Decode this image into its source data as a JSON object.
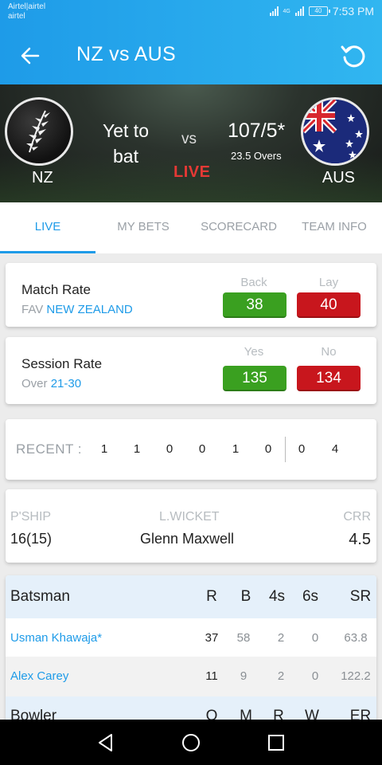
{
  "statusbar": {
    "carrier1": "Airtel|airtel",
    "carrier2": "airtel",
    "network": "4G",
    "battery": "40",
    "time": "7:53 PM"
  },
  "appbar": {
    "title": "NZ vs AUS"
  },
  "match": {
    "home_code": "NZ",
    "away_code": "AUS",
    "home_status": "Yet to bat",
    "vs": "vs",
    "live": "LIVE",
    "away_score": "107/5*",
    "away_overs": "23.5 Overs"
  },
  "tabs": [
    "LIVE",
    "MY BETS",
    "SCORECARD",
    "TEAM INFO"
  ],
  "match_rate": {
    "title": "Match Rate",
    "sub_prefix": "FAV",
    "sub_value": "NEW ZEALAND",
    "back_label": "Back",
    "lay_label": "Lay",
    "back": "38",
    "lay": "40"
  },
  "session_rate": {
    "title": "Session Rate",
    "sub_prefix": "Over",
    "sub_value": "21-30",
    "yes_label": "Yes",
    "no_label": "No",
    "yes": "135",
    "no": "134"
  },
  "recent": {
    "label": "RECENT :",
    "balls": [
      "1",
      "1",
      "0",
      "0",
      "1",
      "0",
      "0",
      "4"
    ]
  },
  "partnership": {
    "pship_label": "P'SHIP",
    "pship_value": "16(15)",
    "wicket_label": "L.WICKET",
    "wicket_value": "Glenn Maxwell",
    "crr_label": "CRR",
    "crr_value": "4.5"
  },
  "batting": {
    "headers": [
      "Batsman",
      "R",
      "B",
      "4s",
      "6s",
      "SR"
    ],
    "rows": [
      [
        "Usman Khawaja*",
        "37",
        "58",
        "2",
        "0",
        "63.8"
      ],
      [
        "Alex Carey",
        "11",
        "9",
        "2",
        "0",
        "122.2"
      ]
    ],
    "bowler_headers": [
      "Bowler",
      "O",
      "M",
      "R",
      "W",
      "ER"
    ]
  },
  "colors": {
    "primary": "#1e9be8",
    "back_green": "#3aa020",
    "lay_red": "#c8161d",
    "live_red": "#e53935"
  },
  "icons": {
    "back": "arrow-left-icon",
    "refresh": "refresh-icon",
    "nav_back": "triangle-back-icon",
    "nav_home": "circle-home-icon",
    "nav_recent": "square-recents-icon"
  }
}
